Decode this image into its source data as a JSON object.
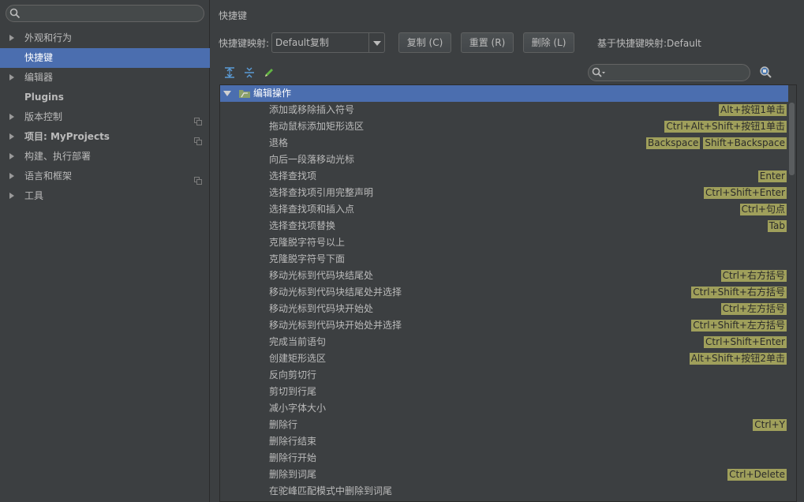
{
  "sidebar": {
    "search_placeholder": "",
    "items": [
      {
        "label": "外观和行为",
        "arrow": true,
        "selected": false
      },
      {
        "label": "快捷键",
        "arrow": false,
        "selected": true
      },
      {
        "label": "编辑器",
        "arrow": true,
        "selected": false
      },
      {
        "label": "Plugins",
        "arrow": false,
        "selected": false
      },
      {
        "label": "版本控制",
        "arrow": true,
        "selected": false,
        "project_icon": true
      },
      {
        "label": "项目: MyProjects",
        "arrow": true,
        "selected": false,
        "project_icon": true
      },
      {
        "label": "构建、执行部署",
        "arrow": true,
        "selected": false
      },
      {
        "label": "语言和框架",
        "arrow": true,
        "selected": false,
        "project_icon": true
      },
      {
        "label": "工具",
        "arrow": true,
        "selected": false
      }
    ]
  },
  "main": {
    "title": "快捷键",
    "keymap_label": "快捷键映射:",
    "keymap_value": "Default复制",
    "buttons": {
      "copy": "复制 (C)",
      "reset": "重置 (R)",
      "delete": "删除 (L)"
    },
    "based_on": "基于快捷键映射:Default",
    "tree": {
      "root_label": "编辑操作",
      "rows": [
        {
          "name": "添加或移除插入符号",
          "keys": [
            "Alt+按钮1单击"
          ]
        },
        {
          "name": "拖动鼠标添加矩形选区",
          "keys": [
            "Ctrl+Alt+Shift+按钮1单击"
          ]
        },
        {
          "name": "退格",
          "keys": [
            "Backspace",
            "Shift+Backspace"
          ]
        },
        {
          "name": "向后一段落移动光标",
          "keys": []
        },
        {
          "name": "选择查找项",
          "keys": [
            "Enter"
          ]
        },
        {
          "name": "选择查找项引用完整声明",
          "keys": [
            "Ctrl+Shift+Enter"
          ]
        },
        {
          "name": "选择查找项和插入点",
          "keys": [
            "Ctrl+句点"
          ]
        },
        {
          "name": "选择查找项替换",
          "keys": [
            "Tab"
          ]
        },
        {
          "name": "克隆脱字符号以上",
          "keys": []
        },
        {
          "name": "克隆脱字符号下面",
          "keys": []
        },
        {
          "name": "移动光标到代码块结尾处",
          "keys": [
            "Ctrl+右方括号"
          ]
        },
        {
          "name": "移动光标到代码块结尾处并选择",
          "keys": [
            "Ctrl+Shift+右方括号"
          ]
        },
        {
          "name": "移动光标到代码块开始处",
          "keys": [
            "Ctrl+左方括号"
          ]
        },
        {
          "name": "移动光标到代码块开始处并选择",
          "keys": [
            "Ctrl+Shift+左方括号"
          ]
        },
        {
          "name": "完成当前语句",
          "keys": [
            "Ctrl+Shift+Enter"
          ]
        },
        {
          "name": "创建矩形选区",
          "keys": [
            "Alt+Shift+按钮2单击"
          ]
        },
        {
          "name": "反向剪切行",
          "keys": []
        },
        {
          "name": "剪切到行尾",
          "keys": []
        },
        {
          "name": "减小字体大小",
          "keys": []
        },
        {
          "name": "删除行",
          "keys": [
            "Ctrl+Y"
          ]
        },
        {
          "name": "删除行结束",
          "keys": []
        },
        {
          "name": "删除行开始",
          "keys": []
        },
        {
          "name": "删除到词尾",
          "keys": [
            "Ctrl+Delete"
          ]
        },
        {
          "name": "在驼峰匹配模式中删除到词尾",
          "keys": []
        }
      ]
    }
  },
  "colors": {
    "background": "#3c3f41",
    "selection": "#4b6eaf",
    "shortcut_badge": "#9f9f5b",
    "text": "#bbbbbb"
  },
  "icons": [
    "search-icon",
    "expand-all-icon",
    "collapse-all-icon",
    "edit-icon",
    "find-by-shortcut-icon",
    "folder-icon",
    "project-icon"
  ]
}
